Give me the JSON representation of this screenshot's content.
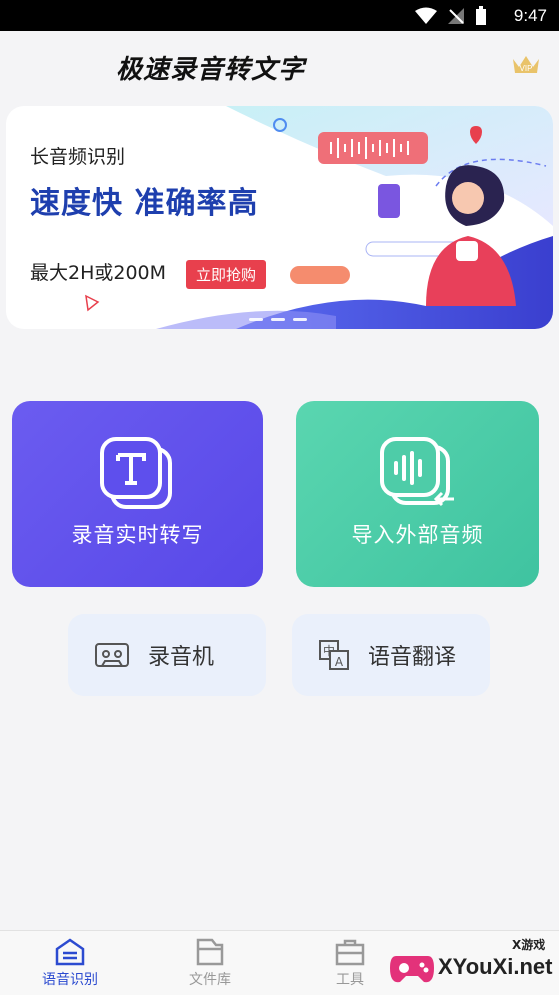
{
  "status_bar": {
    "time": "9:47"
  },
  "app_bar": {
    "title": "极速录音转文字",
    "vip_badge": "VIP"
  },
  "banner": {
    "subtitle": "长音频识别",
    "headline": "速度快  准确率高",
    "limit_text": "最大2H或200M",
    "cta_label": "立即抢购"
  },
  "main_actions": {
    "realtime_label": "录音实时转写",
    "import_label": "导入外部音频"
  },
  "tools": {
    "recorder_label": "录音机",
    "translate_label": "语音翻译"
  },
  "tabs": [
    {
      "label": "语音识别",
      "active": true
    },
    {
      "label": "文件库",
      "active": false
    },
    {
      "label": "工具",
      "active": false
    }
  ],
  "watermark": {
    "brand": "XYouXi.net",
    "small": "X游戏"
  },
  "colors": {
    "accent": "#2c4bd0",
    "card_left": "#5f50ec",
    "card_right": "#4fcda9",
    "cta": "#e8404d"
  }
}
